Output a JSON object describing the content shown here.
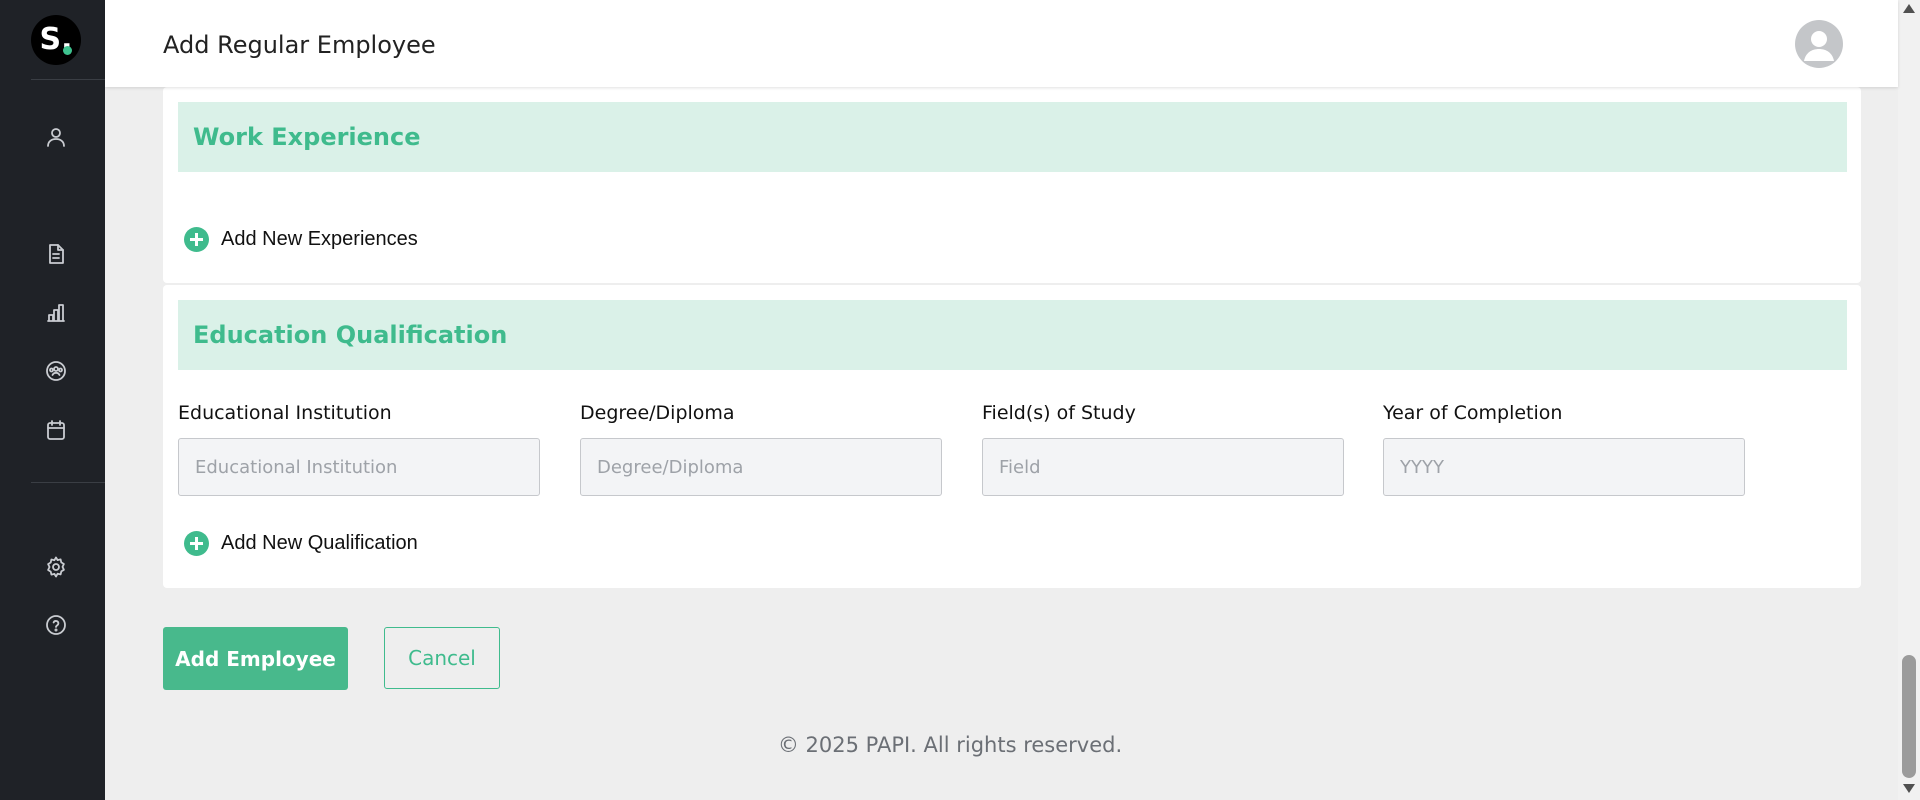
{
  "header": {
    "title": "Add Regular Employee"
  },
  "sidebar": {
    "logo_letter": "S.",
    "items": [
      {
        "name": "user-icon"
      },
      {
        "name": "document-icon"
      },
      {
        "name": "bar-chart-icon"
      },
      {
        "name": "team-icon"
      },
      {
        "name": "calendar-icon"
      },
      {
        "name": "gear-icon"
      },
      {
        "name": "help-icon"
      }
    ]
  },
  "work_experience": {
    "title": "Work Experience",
    "add_label": "Add New Experiences"
  },
  "education": {
    "title": "Education Qualification",
    "fields": [
      {
        "label": "Educational Institution",
        "placeholder": "Educational Institution",
        "value": ""
      },
      {
        "label": "Degree/Diploma",
        "placeholder": "Degree/Diploma",
        "value": ""
      },
      {
        "label": "Field(s) of Study",
        "placeholder": "Field",
        "value": ""
      },
      {
        "label": "Year of Completion",
        "placeholder": "YYYY",
        "value": ""
      }
    ],
    "add_label": "Add New Qualification"
  },
  "actions": {
    "submit_label": "Add Employee",
    "cancel_label": "Cancel"
  },
  "footer": {
    "copyright": "© 2025 PAPI. All rights reserved."
  },
  "colors": {
    "accent": "#48b98c",
    "section_bg": "#daf1e8",
    "sidebar_bg": "#1f2227"
  }
}
